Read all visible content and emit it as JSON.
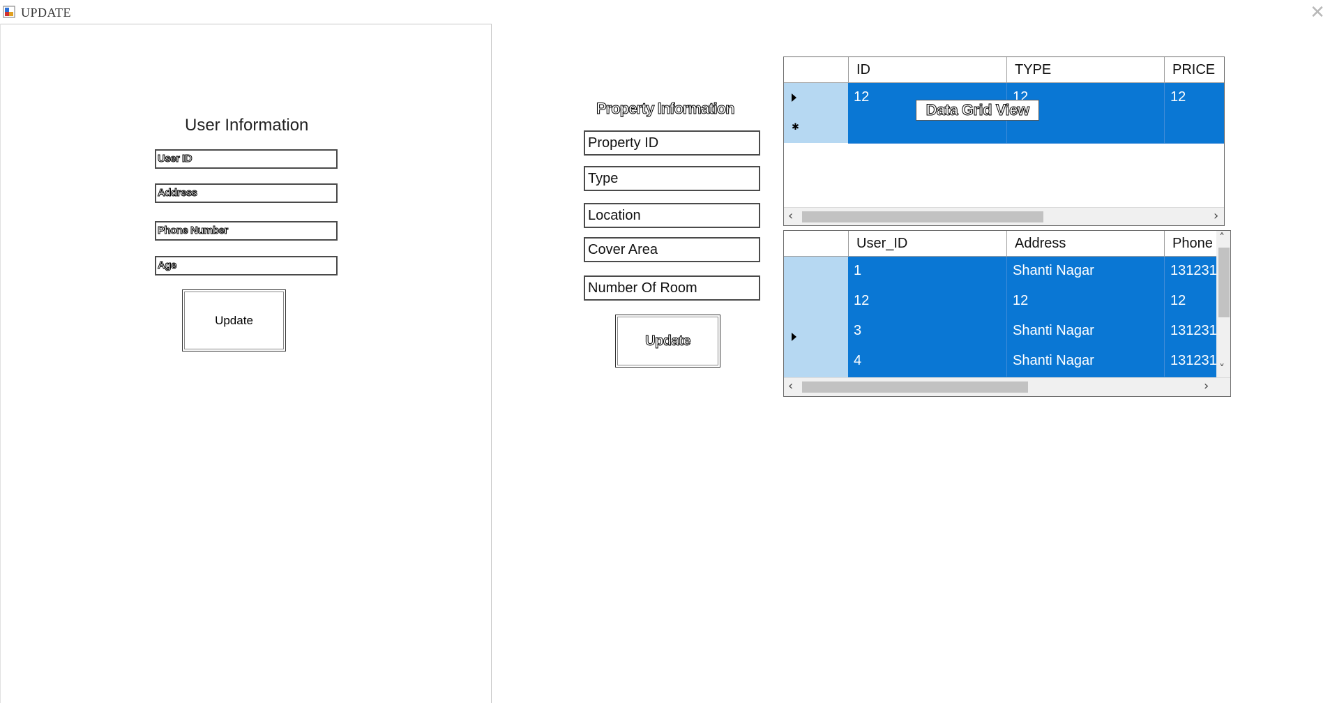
{
  "window": {
    "title": "UPDATE",
    "close_icon": "close-icon"
  },
  "user_section": {
    "heading": "User Information",
    "fields": {
      "user_id": "User ID",
      "address": "Address",
      "phone": "Phone Number",
      "age": "Age"
    },
    "update_label": "Update"
  },
  "property_section": {
    "heading": "Property Information",
    "fields": {
      "property_id": "Property ID",
      "type": "Type",
      "location": "Location",
      "cover_area": "Cover Area",
      "rooms": "Number Of Room"
    },
    "update_label": "Update"
  },
  "property_grid": {
    "columns": [
      "ID",
      "TYPE",
      "PRICE"
    ],
    "rows": [
      {
        "marker": "arrow",
        "cells": [
          "12",
          "12",
          "12"
        ]
      },
      {
        "marker": "star",
        "cells": [
          "",
          "",
          ""
        ]
      }
    ],
    "overlay_label": "Data Grid View"
  },
  "user_grid": {
    "columns": [
      "User_ID",
      "Address",
      "Phone"
    ],
    "rows": [
      {
        "marker": "",
        "cells": [
          "1",
          "Shanti Nagar",
          "131231"
        ]
      },
      {
        "marker": "",
        "cells": [
          "12",
          "12",
          "12"
        ]
      },
      {
        "marker": "arrow",
        "cells": [
          "3",
          "Shanti Nagar",
          "131231"
        ]
      },
      {
        "marker": "",
        "cells": [
          "4",
          "Shanti Nagar",
          "131231"
        ]
      }
    ]
  },
  "colors": {
    "selection": "#0a77d4",
    "row_header": "#b6d8f2",
    "scrollbar_track": "#f0f0f0",
    "scrollbar_thumb": "#c2c2c2"
  }
}
